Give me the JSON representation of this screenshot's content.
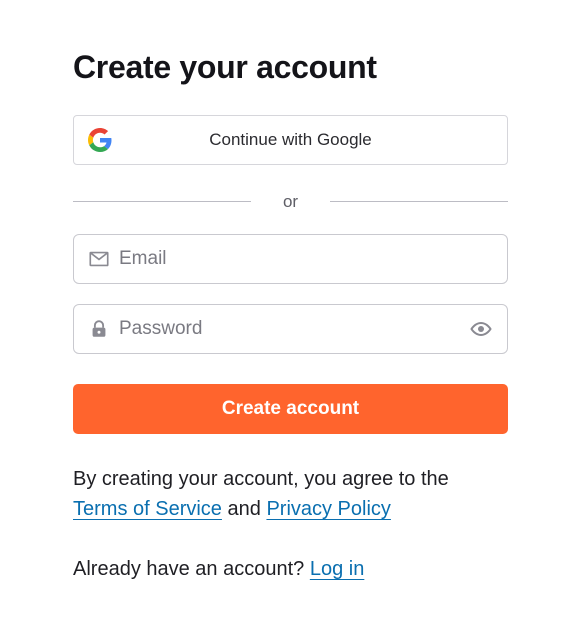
{
  "header": {
    "title": "Create your account"
  },
  "google": {
    "label": "Continue with Google",
    "icon": "google-g-icon"
  },
  "divider": {
    "text": "or"
  },
  "email": {
    "placeholder": "Email",
    "value": "",
    "icon": "mail-icon"
  },
  "password": {
    "placeholder": "Password",
    "value": "",
    "icon": "lock-icon",
    "toggle_icon": "eye-icon"
  },
  "submit": {
    "label": "Create account"
  },
  "terms": {
    "prefix": "By creating your account, you agree to the",
    "tos_link": "Terms of Service",
    "and": "and",
    "privacy_link": "Privacy Policy"
  },
  "login": {
    "prompt": "Already have an account?",
    "link": "Log in"
  },
  "colors": {
    "primary_button": "#ff642d",
    "link": "#0a6fb0"
  }
}
